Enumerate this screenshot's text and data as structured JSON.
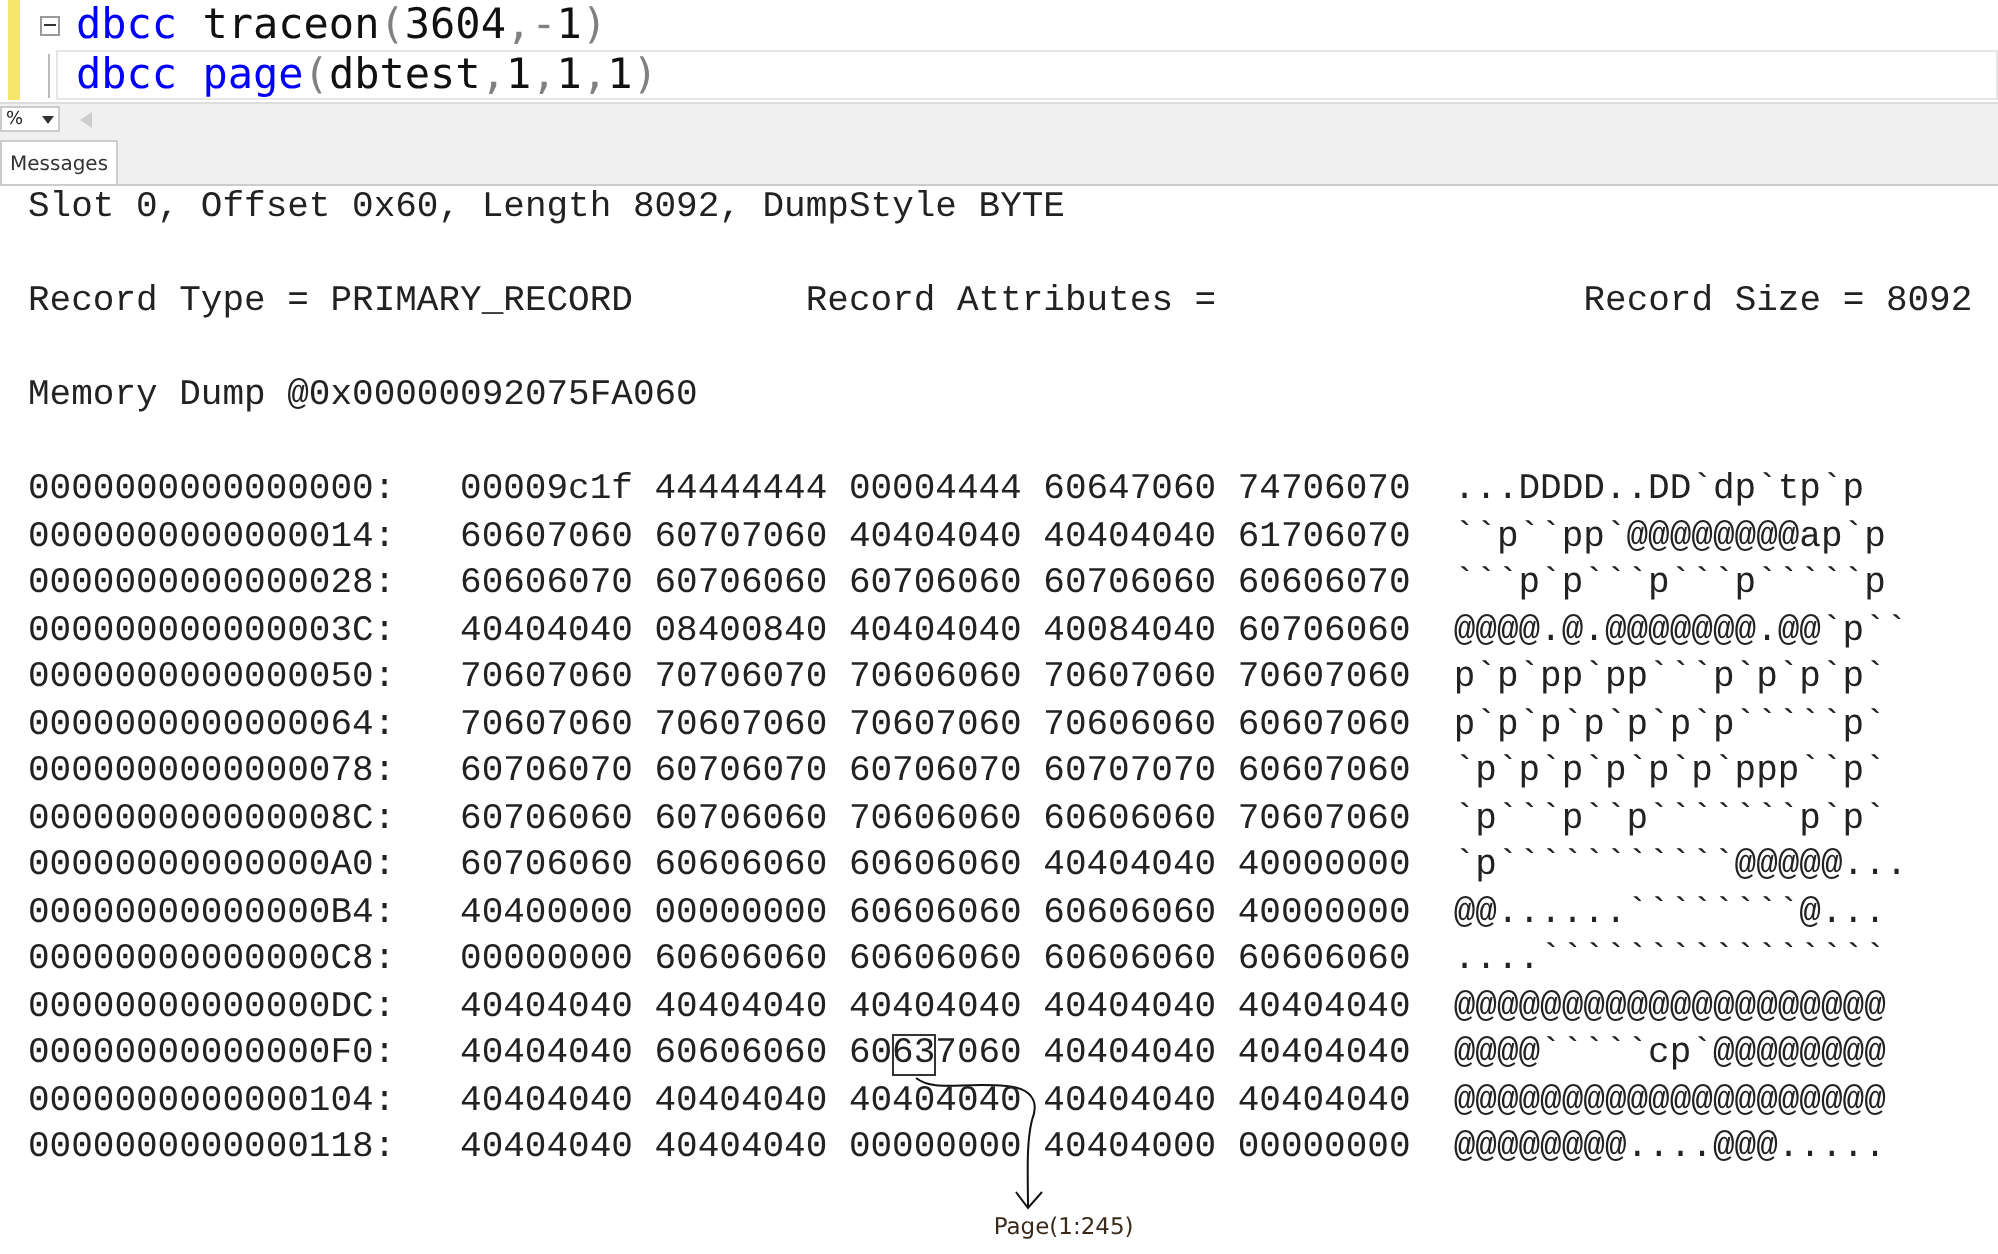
{
  "editor": {
    "lines": [
      {
        "collapsible": true,
        "current": false,
        "tokens": [
          {
            "text": "dbcc",
            "kind": "keyword"
          },
          {
            "text": " traceon",
            "kind": "plain"
          },
          {
            "text": "(",
            "kind": "operator"
          },
          {
            "text": "3604",
            "kind": "plain"
          },
          {
            "text": ",-",
            "kind": "operator"
          },
          {
            "text": "1",
            "kind": "plain"
          },
          {
            "text": ")",
            "kind": "operator"
          }
        ]
      },
      {
        "collapsible": false,
        "current": true,
        "tokens": [
          {
            "text": "dbcc",
            "kind": "keyword"
          },
          {
            "text": " page",
            "kind": "keyword"
          },
          {
            "text": "(",
            "kind": "operator"
          },
          {
            "text": "dbtest",
            "kind": "plain"
          },
          {
            "text": ",",
            "kind": "operator"
          },
          {
            "text": "1",
            "kind": "plain"
          },
          {
            "text": ",",
            "kind": "operator"
          },
          {
            "text": "1",
            "kind": "plain"
          },
          {
            "text": ",",
            "kind": "operator"
          },
          {
            "text": "1",
            "kind": "plain"
          },
          {
            "text": ")",
            "kind": "operator"
          }
        ]
      }
    ]
  },
  "zoom": {
    "value": "%"
  },
  "tabs": [
    {
      "label": "Messages",
      "selected": true
    }
  ],
  "messages": {
    "slot_line": "Slot 0, Offset 0x60, Length 8092, DumpStyle BYTE",
    "record_line": [
      "Record Type = PRIMARY_RECORD",
      "Record Attributes =",
      "Record Size = 8092"
    ],
    "memory_line": "Memory Dump @0x00000092075FA060",
    "rows": [
      {
        "address": "0000000000000000:",
        "hex": [
          "00009c1f",
          "44444444",
          "00004444",
          "60647060",
          "74706070"
        ],
        "ascii": "...DDDD..DD`dp`tp`p",
        "highlighted": false
      },
      {
        "address": "0000000000000014:",
        "hex": [
          "60607060",
          "60707060",
          "40404040",
          "40404040",
          "61706070"
        ],
        "ascii": "``p``pp`@@@@@@@@ap`p",
        "highlighted": false
      },
      {
        "address": "0000000000000028:",
        "hex": [
          "60606070",
          "60706060",
          "60706060",
          "60706060",
          "60606070"
        ],
        "ascii": "```p`p```p```p`````p",
        "highlighted": false
      },
      {
        "address": "000000000000003C:",
        "hex": [
          "40404040",
          "08400840",
          "40404040",
          "40084040",
          "60706060"
        ],
        "ascii": "@@@@.@.@@@@@@@.@@`p``",
        "highlighted": false
      },
      {
        "address": "0000000000000050:",
        "hex": [
          "70607060",
          "70706070",
          "70606060",
          "70607060",
          "70607060"
        ],
        "ascii": "p`p`pp`pp```p`p`p`p`",
        "highlighted": false
      },
      {
        "address": "0000000000000064:",
        "hex": [
          "70607060",
          "70607060",
          "70607060",
          "70606060",
          "60607060"
        ],
        "ascii": "p`p`p`p`p`p`p`````p`",
        "highlighted": false
      },
      {
        "address": "0000000000000078:",
        "hex": [
          "60706070",
          "60706070",
          "60706070",
          "60707070",
          "60607060"
        ],
        "ascii": "`p`p`p`p`p`p`ppp``p`",
        "highlighted": false
      },
      {
        "address": "000000000000008C:",
        "hex": [
          "60706060",
          "60706060",
          "70606060",
          "60606060",
          "70607060"
        ],
        "ascii": "`p```p``p```````p`p`",
        "highlighted": false
      },
      {
        "address": "00000000000000A0:",
        "hex": [
          "60706060",
          "60606060",
          "60606060",
          "40404040",
          "40000000"
        ],
        "ascii": "`p```````````@@@@@...",
        "highlighted": false
      },
      {
        "address": "00000000000000B4:",
        "hex": [
          "40400000",
          "00000000",
          "60606060",
          "60606060",
          "40000000"
        ],
        "ascii": "@@......````````@...",
        "highlighted": false
      },
      {
        "address": "00000000000000C8:",
        "hex": [
          "00000000",
          "60606060",
          "60606060",
          "60606060",
          "60606060"
        ],
        "ascii": "....````````````````",
        "highlighted": false
      },
      {
        "address": "00000000000000DC:",
        "hex": [
          "40404040",
          "40404040",
          "40404040",
          "40404040",
          "40404040"
        ],
        "ascii": "@@@@@@@@@@@@@@@@@@@@",
        "highlighted": false
      },
      {
        "address": "00000000000000F0:",
        "hex": [
          "40404040",
          "60606060",
          "60637060",
          "40404040",
          "40404040"
        ],
        "ascii": "@@@@`````cp`@@@@@@@@",
        "highlighted": true
      },
      {
        "address": "0000000000000104:",
        "hex": [
          "40404040",
          "40404040",
          "40404040",
          "40404040",
          "40404040"
        ],
        "ascii": "@@@@@@@@@@@@@@@@@@@@",
        "highlighted": false
      },
      {
        "address": "0000000000000118:",
        "hex": [
          "40404040",
          "40404040",
          "00000000",
          "40404000",
          "00000000"
        ],
        "ascii": "@@@@@@@@....@@@.....",
        "highlighted": false
      }
    ],
    "annotation": {
      "label": "Page(1:245)"
    }
  }
}
